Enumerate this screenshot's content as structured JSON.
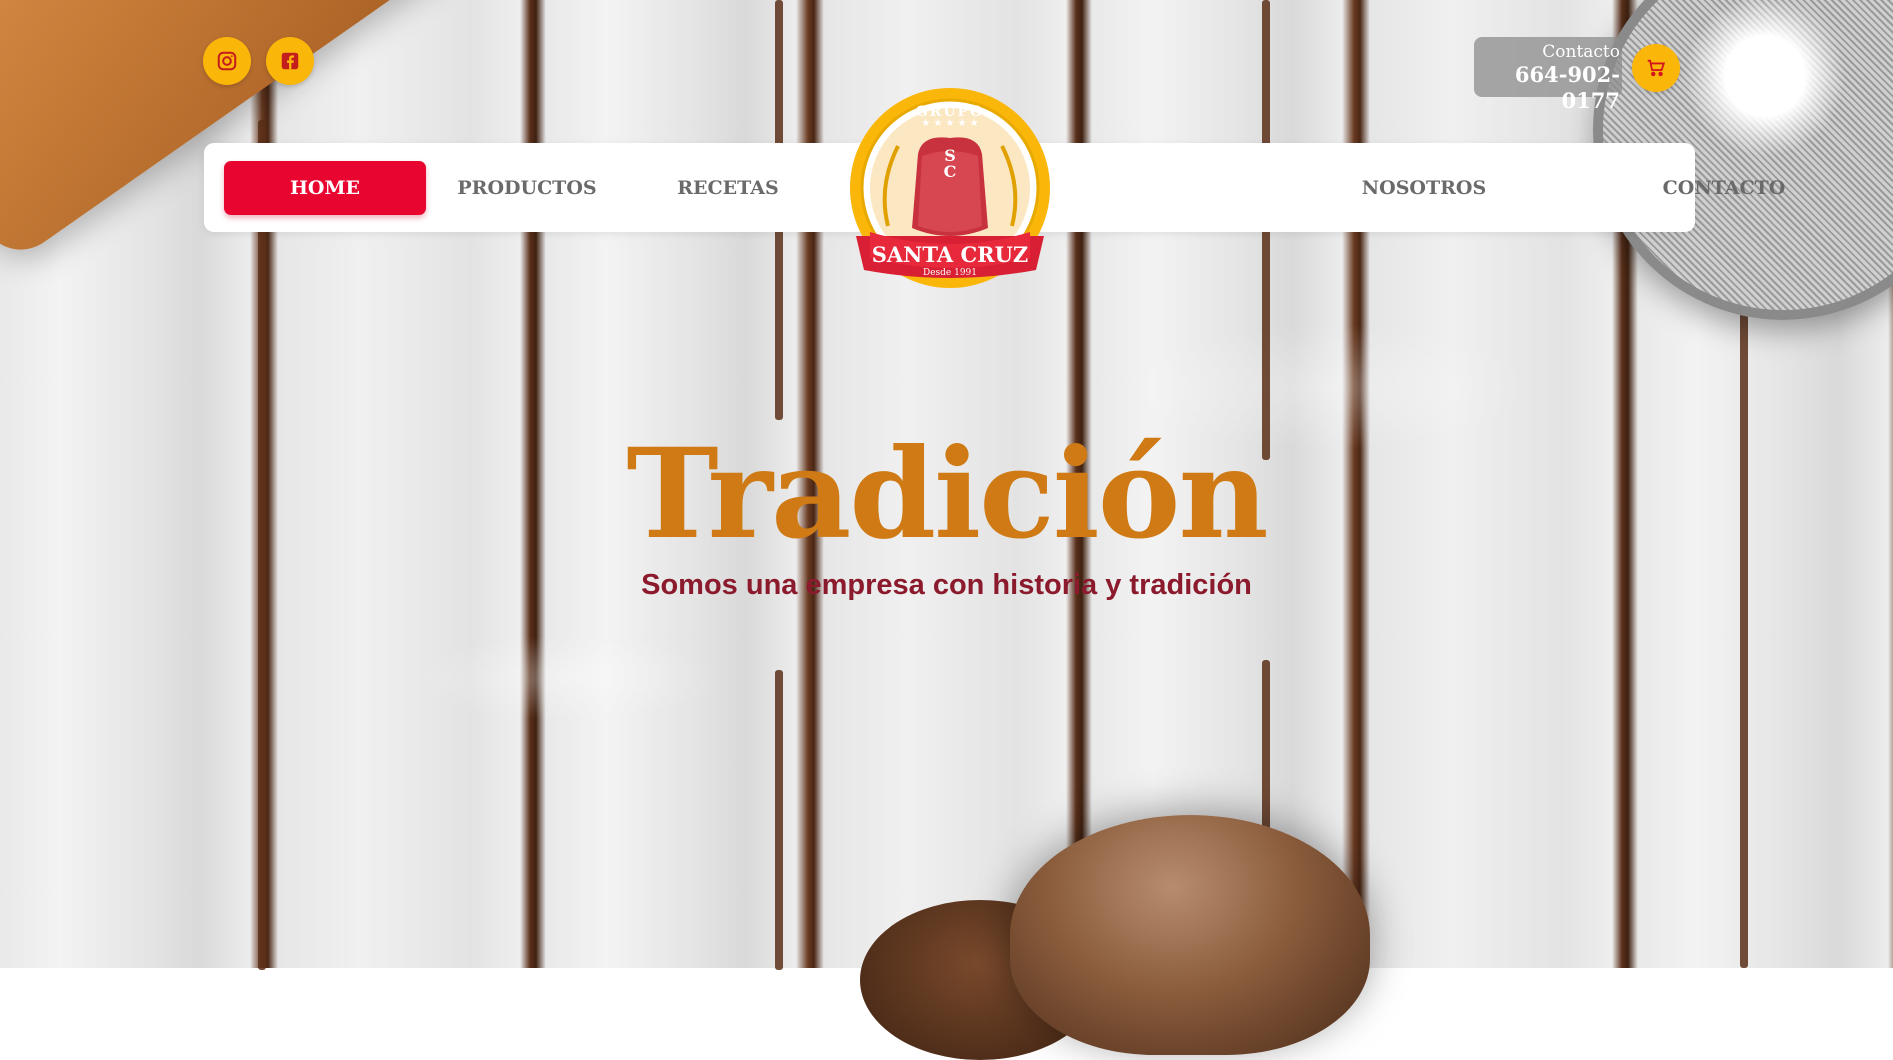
{
  "social": {
    "instagram_icon": "instagram-icon",
    "facebook_icon": "facebook-icon"
  },
  "contact": {
    "label": "Contacto",
    "phone": "664-902-0177"
  },
  "cart_icon": "shopping-cart-icon",
  "nav": {
    "items": [
      {
        "label": "HOME",
        "active": true
      },
      {
        "label": "PRODUCTOS",
        "active": false
      },
      {
        "label": "RECETAS",
        "active": false
      },
      {
        "label": "NOSOTROS",
        "active": false
      },
      {
        "label": "CONTACTO",
        "active": false
      }
    ]
  },
  "logo": {
    "top_text": "GRUPO",
    "monogram_top": "S",
    "monogram_bottom": "C",
    "brand": "SANTA CRUZ",
    "since": "Desde 1991"
  },
  "hero": {
    "title": "Tradición",
    "subtitle": "Somos una empresa con historia y tradición"
  },
  "colors": {
    "accent_yellow": "#fbb60a",
    "nav_active": "#e8052f",
    "hero_title": "#cf7a14",
    "hero_subtitle": "#8b1a2d"
  }
}
